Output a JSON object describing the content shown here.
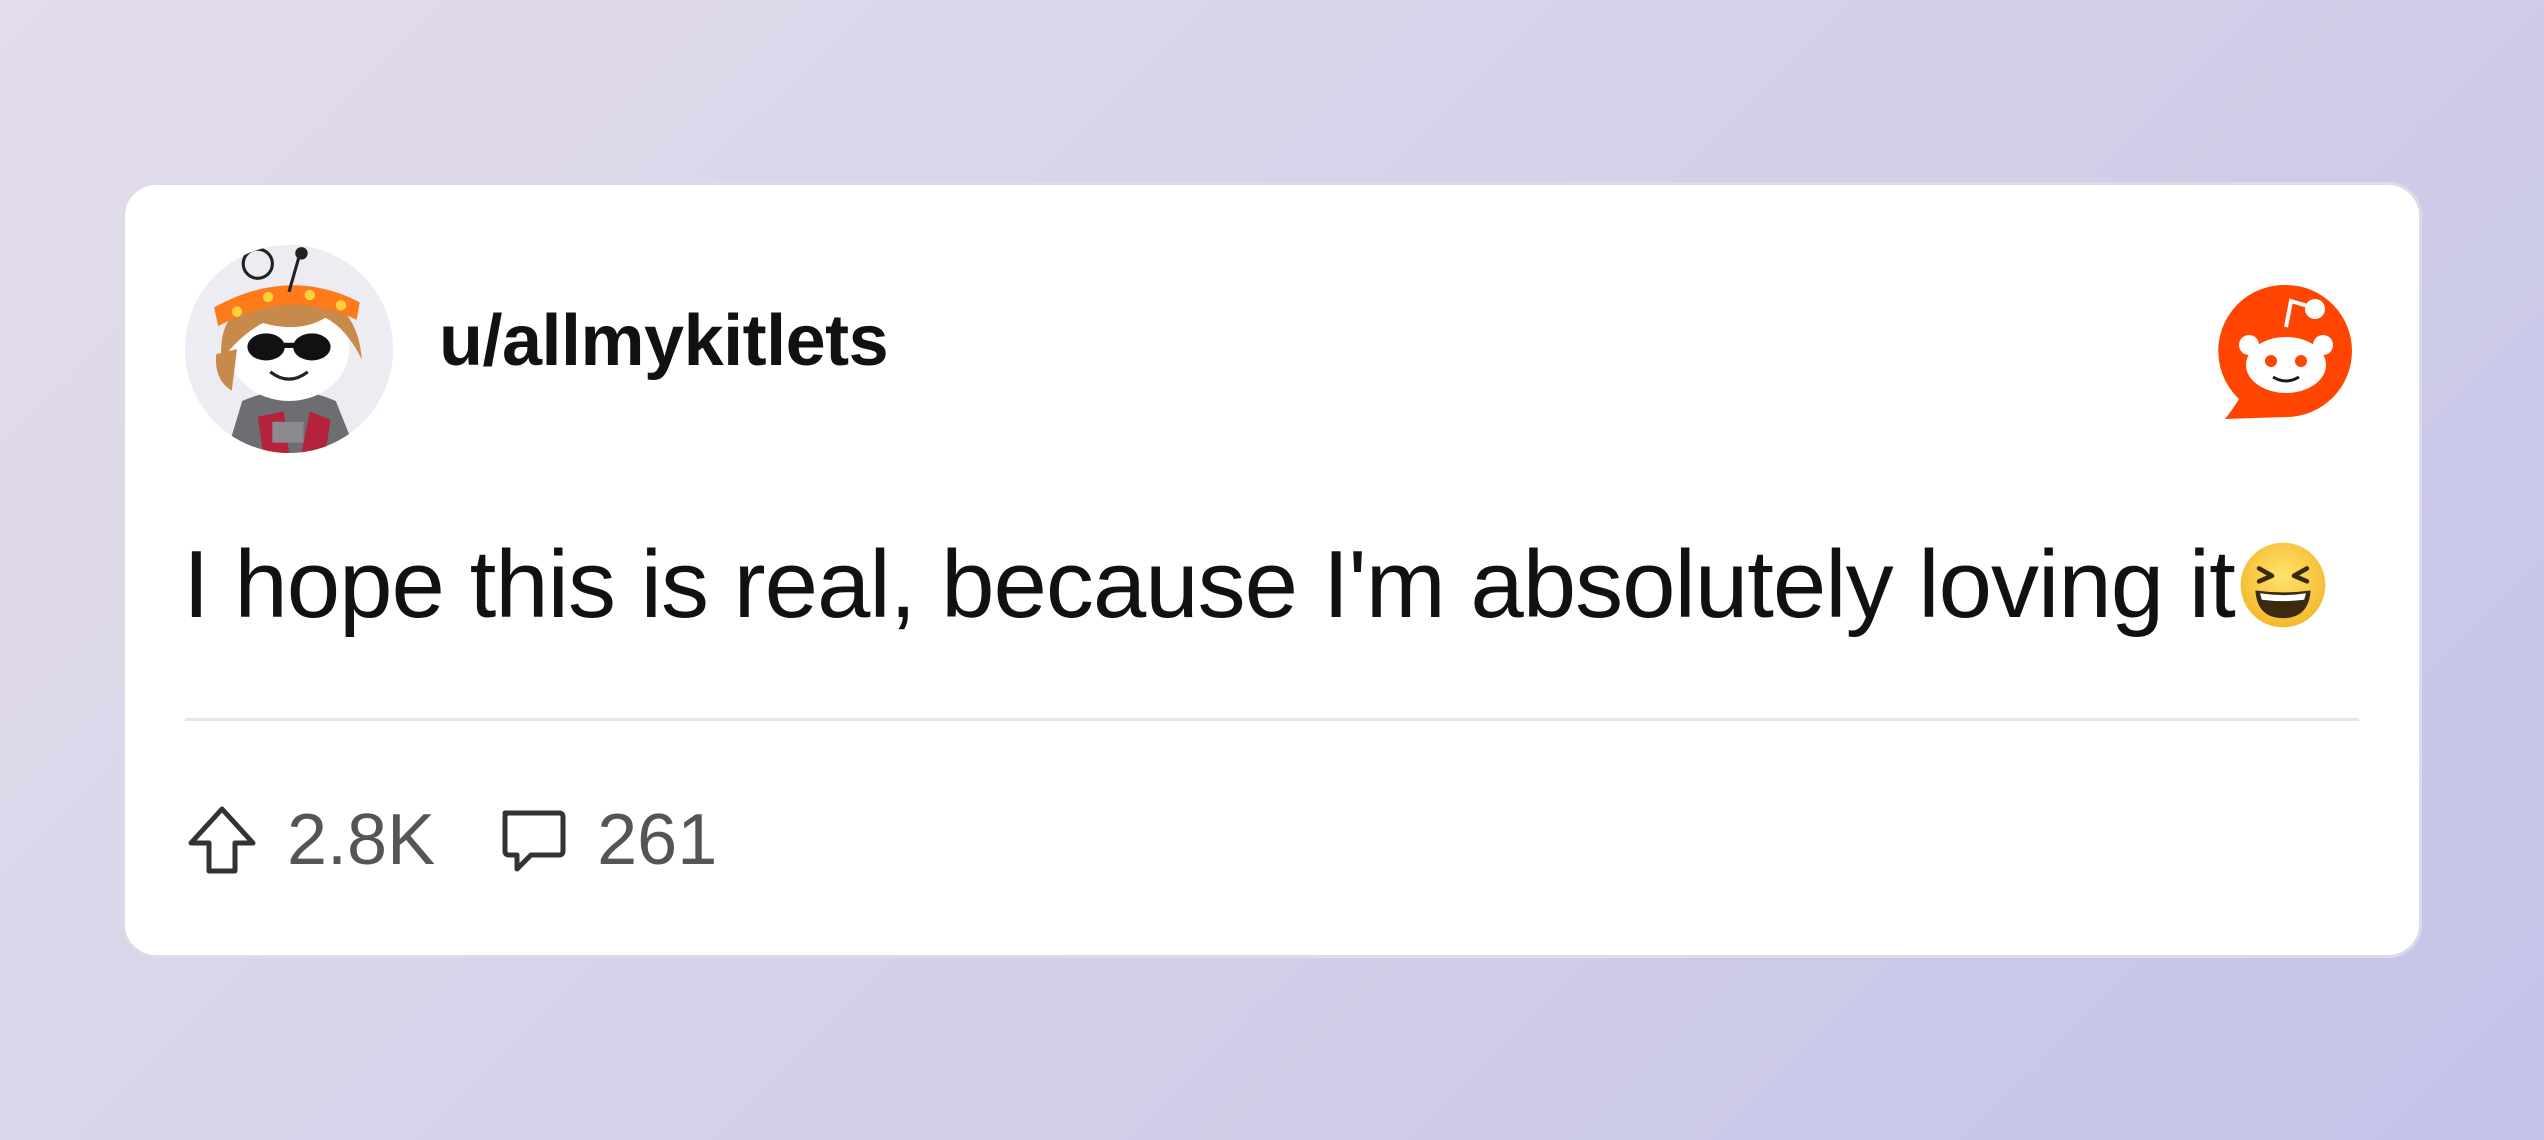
{
  "post": {
    "username": "u/allmykitlets",
    "text": "I hope this is real, because I'm absolutely loving it",
    "emoji": "😆",
    "upvotes": "2.8K",
    "comments": "261"
  },
  "icons": {
    "avatar": "snoo-avatar-sunglasses",
    "logo": "reddit-logo-icon",
    "upvote": "upvote-arrow-icon",
    "comment": "comment-bubble-icon",
    "emoji": "grinning-squinting-face-emoji"
  },
  "colors": {
    "brand": "#ff4500",
    "text": "#111111",
    "muted": "#555555"
  }
}
